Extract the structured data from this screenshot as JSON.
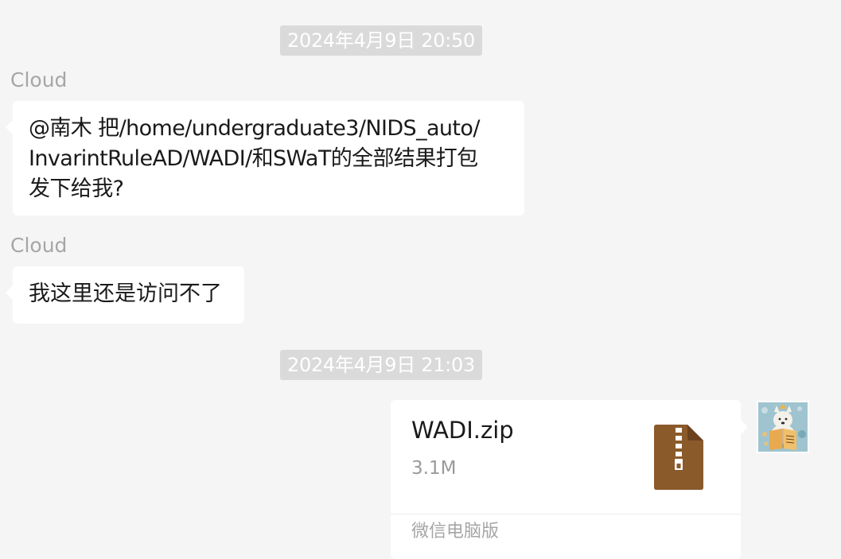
{
  "messages": [
    {
      "timestamp": "2024年4月9日 20:50",
      "sender": "Cloud",
      "lines": [
        "@南木 把/home/undergraduate3/NIDS_auto/",
        "InvarintRuleAD/WADI/和SWaT的全部结果打包",
        "发下给我?"
      ]
    },
    {
      "sender": "Cloud",
      "text": "我这里还是访问不了"
    },
    {
      "timestamp": "2024年4月9日 21:03"
    }
  ],
  "file_message": {
    "name": "WADI.zip",
    "size": "3.1M",
    "source": "微信电脑版",
    "icon": "zip-file-icon",
    "icon_color": "#8b5a2b"
  },
  "avatar": {
    "icon": "avatar-dog-reading-book"
  },
  "colors": {
    "background": "#f5f5f5",
    "bubble": "#ffffff",
    "timestamp_bg": "#dadada",
    "sender_text": "#a6a6a6"
  }
}
